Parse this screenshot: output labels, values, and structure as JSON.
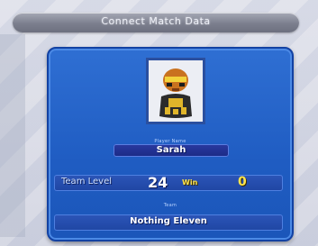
{
  "screen": {
    "title": "Connect Match Data"
  },
  "profile": {
    "name_caption": "Player Name",
    "player_name": "Sarah",
    "portrait_icon": "character-portrait"
  },
  "stats": {
    "team_level_label": "Team Level",
    "team_level_value": "24",
    "win_label": "Win",
    "win_value": "0"
  },
  "team": {
    "team_caption": "Team",
    "team_name": "Nothing Eleven"
  },
  "colors": {
    "panel_blue": "#1f5cc2",
    "accent_yellow": "#ffe44a",
    "titlebar_gray": "#7c7f8e"
  }
}
